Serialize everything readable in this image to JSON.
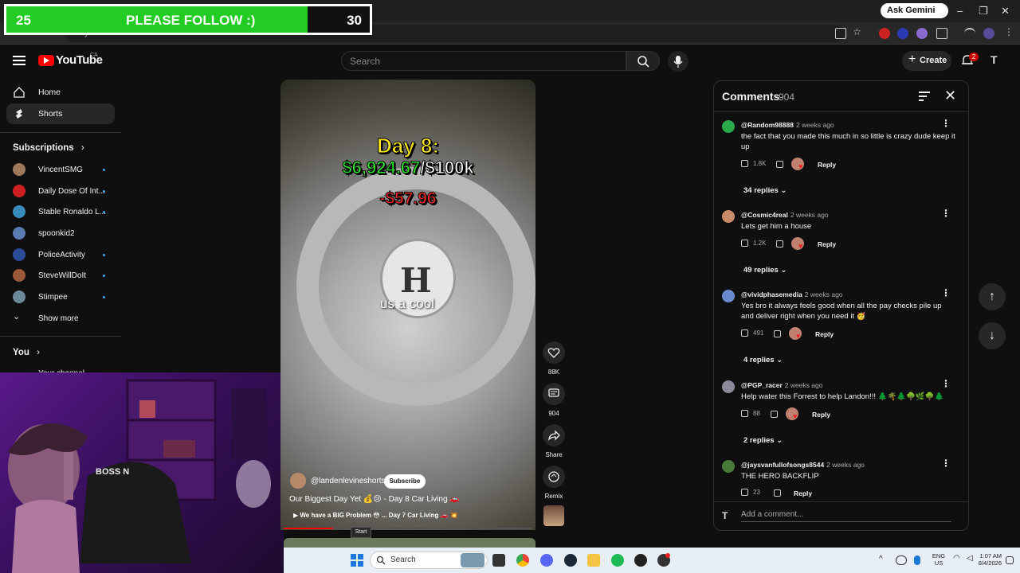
{
  "overlay": {
    "left_value": "25",
    "label": "PLEASE FOLLOW :)",
    "right_value": "30",
    "progress_fraction": 0.83
  },
  "browser": {
    "ask_gemini": "Ask Gemini",
    "address": "youtube.com/shorts/..."
  },
  "header": {
    "logo": "YouTube",
    "region": "CA",
    "search_placeholder": "Search",
    "create_label": "Create",
    "notif_count": "2",
    "avatar_letter": "T"
  },
  "sidebar": {
    "items": [
      {
        "label": "Home"
      },
      {
        "label": "Shorts"
      }
    ],
    "subscriptions_title": "Subscriptions",
    "subscriptions": [
      {
        "name": "VincentSMG",
        "color": "#a0785a"
      },
      {
        "name": "Daily Dose Of Int...",
        "color": "#cc2222"
      },
      {
        "name": "Stable Ronaldo L...",
        "color": "#3a8bbd"
      },
      {
        "name": "spoonkid2",
        "color": "#5a7ab0"
      },
      {
        "name": "PoliceActivity",
        "color": "#2a4a9a"
      },
      {
        "name": "SteveWillDoIt",
        "color": "#9a5a3a"
      },
      {
        "name": "Stimpee",
        "color": "#6a8a9a"
      }
    ],
    "show_more": "Show more",
    "you_title": "You",
    "your_channel": "Your channel"
  },
  "video": {
    "day_title": "Day 8:",
    "amount_green": "$6,924.67",
    "amount_goal": "/$100k",
    "loss": "-$57.96",
    "caption": "us a cool",
    "channel": "@landenlevineshorts",
    "subscribe": "Subscribe",
    "title": "Our Biggest Day Yet 💰😢 - Day 8 Car Living 🚗",
    "next": "▶ We have a BIG Problem 😳 ... Day 7 Car Living 🚗 💥",
    "progress_fraction": 0.2
  },
  "actions": {
    "likes": "88K",
    "comments": "904",
    "share": "Share",
    "remix": "Remix"
  },
  "comments": {
    "title": "Comments",
    "count": "904",
    "items": [
      {
        "user": "@Random98888",
        "time": "2 weeks ago",
        "text": "the fact that you made this much in so little is crazy dude keep it up",
        "likes": "1.8K",
        "reply": "Reply",
        "replies": "34 replies",
        "color": "#2aa84a"
      },
      {
        "user": "@Cosmic4real",
        "time": "2 weeks ago",
        "text": "Lets get him a house",
        "likes": "1.2K",
        "reply": "Reply",
        "replies": "49 replies",
        "color": "#c98a6a"
      },
      {
        "user": "@vividphasemedia",
        "time": "2 weeks ago",
        "text": "Yes bro it always feels good when all the pay checks pile up and deliver right when you need it 🥳",
        "likes": "491",
        "reply": "Reply",
        "replies": "4 replies",
        "color": "#6a8ad0"
      },
      {
        "user": "@PGP_racer",
        "time": "2 weeks ago",
        "text": "Help water this Forrest to help Landon!!! 🌲🌴🌲🌳🌿🌳🌲",
        "likes": "88",
        "reply": "Reply",
        "replies": "2 replies",
        "color": "#8a8a9a"
      },
      {
        "user": "@jaysvanfullofsongs8544",
        "time": "2 weeks ago",
        "text": "THE HERO BACKFLIP",
        "likes": "23",
        "reply": "Reply",
        "replies": "",
        "color": "#4a7a3a"
      }
    ],
    "add_placeholder": "Add a comment...",
    "avatar_letter": "T"
  },
  "taskbar": {
    "search": "Search",
    "tooltip": "Start",
    "lang": "ENG",
    "region": "US",
    "time": "1:07 AM",
    "date": "8/4/2026"
  }
}
